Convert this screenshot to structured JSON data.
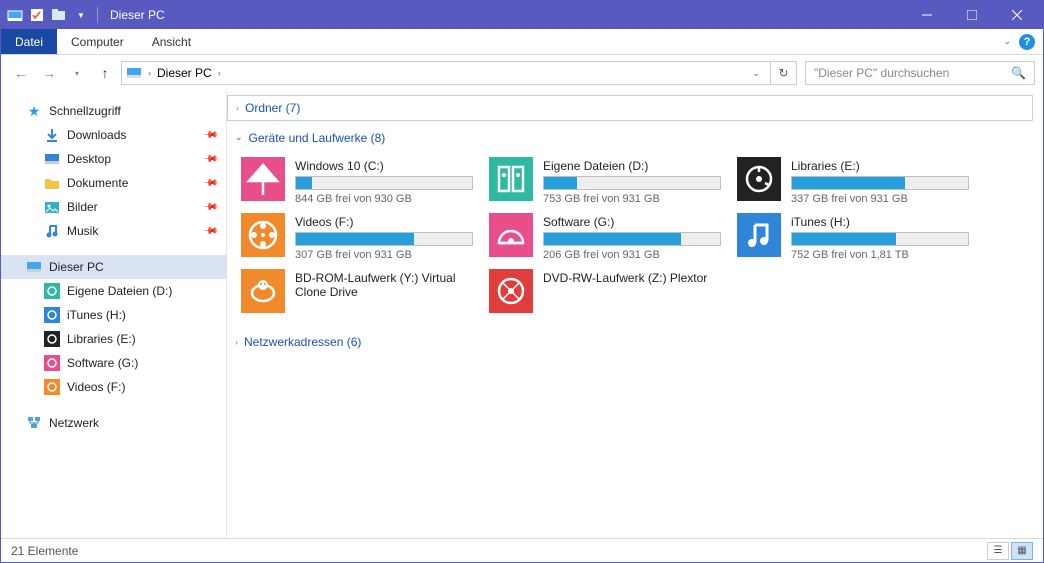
{
  "window": {
    "title": "Dieser PC"
  },
  "ribbon": {
    "file": "Datei",
    "computer": "Computer",
    "view": "Ansicht"
  },
  "breadcrumb": {
    "root": "Dieser PC"
  },
  "search": {
    "placeholder": "\"Dieser PC\" durchsuchen"
  },
  "sidebar": {
    "quick": "Schnellzugriff",
    "quick_items": [
      {
        "label": "Downloads",
        "icon": "download",
        "color": "#2f86d9"
      },
      {
        "label": "Desktop",
        "icon": "desktop",
        "color": "#2f86d9"
      },
      {
        "label": "Dokumente",
        "icon": "folder",
        "color": "#f0c64a"
      },
      {
        "label": "Bilder",
        "icon": "pictures",
        "color": "#35b0c7"
      },
      {
        "label": "Musik",
        "icon": "music",
        "color": "#2f86d9"
      }
    ],
    "this_pc": "Dieser PC",
    "drives": [
      {
        "label": "Eigene Dateien (D:)",
        "color": "#2fb9a3"
      },
      {
        "label": "iTunes (H:)",
        "color": "#2f86d9"
      },
      {
        "label": "Libraries (E:)",
        "color": "#222"
      },
      {
        "label": "Software (G:)",
        "color": "#e84f8a"
      },
      {
        "label": "Videos (F:)",
        "color": "#f08a2a"
      }
    ],
    "network": "Netzwerk"
  },
  "groups": {
    "folders": "Ordner (7)",
    "drives": "Geräte und Laufwerke (8)",
    "network": "Netzwerkadressen (6)"
  },
  "drives": [
    {
      "name": "Windows 10 (C:)",
      "stat": "844 GB frei von 930 GB",
      "pct": 9,
      "color": "#e84f8a",
      "sym": "umbrella"
    },
    {
      "name": "Eigene Dateien (D:)",
      "stat": "753 GB frei von 931 GB",
      "pct": 19,
      "color": "#2fb9a3",
      "sym": "binders"
    },
    {
      "name": "Libraries (E:)",
      "stat": "337 GB frei von 931 GB",
      "pct": 64,
      "color": "#222",
      "sym": "disc"
    },
    {
      "name": "Videos (F:)",
      "stat": "307 GB frei von 931 GB",
      "pct": 67,
      "color": "#f08a2a",
      "sym": "reel"
    },
    {
      "name": "Software (G:)",
      "stat": "206 GB frei von 931 GB",
      "pct": 78,
      "color": "#e84f8a",
      "sym": "disc2"
    },
    {
      "name": "iTunes (H:)",
      "stat": "752 GB frei von 1,81 TB",
      "pct": 59,
      "color": "#2f86d9",
      "sym": "note"
    },
    {
      "name": "BD-ROM-Laufwerk (Y:) Virtual Clone Drive",
      "stat": "",
      "pct": -1,
      "color": "#f08a2a",
      "sym": "sheep"
    },
    {
      "name": "DVD-RW-Laufwerk (Z:) Plextor",
      "stat": "",
      "pct": -1,
      "color": "#e23d3d",
      "sym": "dvd"
    }
  ],
  "status": {
    "items": "21 Elemente"
  }
}
